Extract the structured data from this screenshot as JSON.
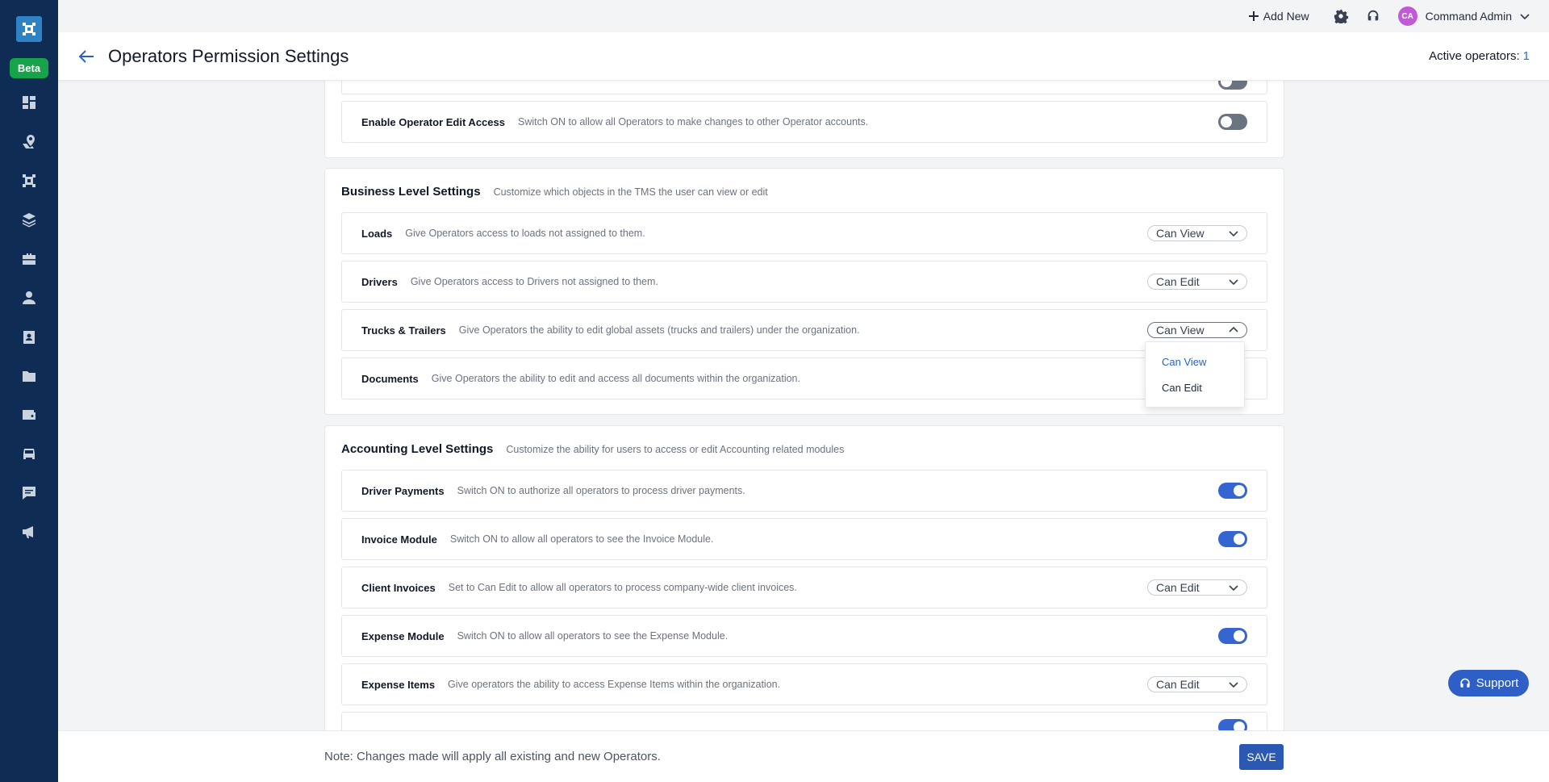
{
  "sidebar": {
    "beta_label": "Beta",
    "nav_icons": [
      "dashboard-icon",
      "map-pin-icon",
      "logo-grid-icon",
      "layers-icon",
      "briefcase-icon",
      "user-icon",
      "contact-card-icon",
      "folder-icon",
      "wallet-icon",
      "truck-icon",
      "message-icon",
      "megaphone-icon"
    ]
  },
  "topbar": {
    "add_new": "Add New",
    "user_initials": "CA",
    "user_name": "Command Admin"
  },
  "header": {
    "title": "Operators Permission Settings",
    "active_label": "Active operators:",
    "active_count": "1"
  },
  "operator_section": {
    "rows": [
      {
        "title": "Enable Operator Edit Access",
        "desc": "Switch ON to allow all Operators to make changes to other Operator accounts.",
        "control": "toggle",
        "state": "off"
      }
    ]
  },
  "business": {
    "title": "Business Level Settings",
    "desc": "Customize which objects in the TMS the user can view or edit",
    "rows": [
      {
        "title": "Loads",
        "desc": "Give Operators access to loads not assigned to them.",
        "value": "Can View"
      },
      {
        "title": "Drivers",
        "desc": "Give Operators access to Drivers not assigned to them.",
        "value": "Can Edit"
      },
      {
        "title": "Trucks & Trailers",
        "desc": "Give Operators the ability to edit global assets (trucks and trailers) under the organization.",
        "value": "Can View"
      },
      {
        "title": "Documents",
        "desc": "Give Operators the ability to edit and access all documents within the organization."
      }
    ],
    "dropdown_options": [
      "Can View",
      "Can Edit"
    ]
  },
  "accounting": {
    "title": "Accounting Level Settings",
    "desc": "Customize the ability for users to access or edit Accounting related modules",
    "rows": [
      {
        "title": "Driver Payments",
        "desc": "Switch ON to authorize all operators to process driver payments.",
        "state": "on"
      },
      {
        "title": "Invoice Module",
        "desc": "Switch ON to allow all operators to see the Invoice Module.",
        "state": "on"
      },
      {
        "title": "Client Invoices",
        "desc": "Set to Can Edit to allow all operators to process company-wide client invoices.",
        "value": "Can Edit"
      },
      {
        "title": "Expense Module",
        "desc": "Switch ON to allow all operators to see the Expense Module.",
        "state": "on"
      },
      {
        "title": "Expense Items",
        "desc": "Give operators the ability to access Expense Items within the organization.",
        "value": "Can Edit"
      }
    ]
  },
  "footer": {
    "note": "Note: Changes made will apply all existing and new Operators.",
    "save_label": "SAVE"
  },
  "support_label": "Support",
  "colors": {
    "sidebar_bg": "#0f2c54",
    "accent": "#2b58b3",
    "toggle_on": "#3565d0",
    "beta": "#16a34a"
  }
}
